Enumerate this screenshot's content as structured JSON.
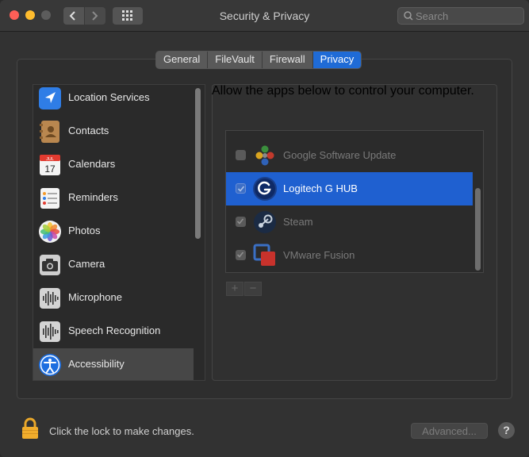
{
  "window": {
    "title": "Security & Privacy"
  },
  "toolbar": {
    "search_placeholder": "Search"
  },
  "tabs": [
    {
      "label": "General",
      "active": false
    },
    {
      "label": "FileVault",
      "active": false
    },
    {
      "label": "Firewall",
      "active": false
    },
    {
      "label": "Privacy",
      "active": true
    }
  ],
  "sidebar": {
    "items": [
      {
        "label": "Location Services",
        "icon": "location-arrow-icon"
      },
      {
        "label": "Contacts",
        "icon": "contacts-book-icon"
      },
      {
        "label": "Calendars",
        "icon": "calendar-icon",
        "icon_month": "JUL",
        "icon_day": "17"
      },
      {
        "label": "Reminders",
        "icon": "reminders-list-icon"
      },
      {
        "label": "Photos",
        "icon": "photos-flower-icon"
      },
      {
        "label": "Camera",
        "icon": "camera-icon"
      },
      {
        "label": "Microphone",
        "icon": "microphone-waveform-icon"
      },
      {
        "label": "Speech Recognition",
        "icon": "speech-waveform-icon"
      },
      {
        "label": "Accessibility",
        "icon": "accessibility-person-icon",
        "selected": true
      }
    ]
  },
  "main": {
    "description": "Allow the apps below to control your computer.",
    "apps": [
      {
        "name": "Google Software Update",
        "checked": false,
        "selected": false
      },
      {
        "name": "Logitech G HUB",
        "checked": true,
        "selected": true
      },
      {
        "name": "Steam",
        "checked": true,
        "selected": false
      },
      {
        "name": "VMware Fusion",
        "checked": true,
        "selected": false
      }
    ],
    "add_label": "+",
    "remove_label": "−"
  },
  "footer": {
    "lock_text": "Click the lock to make changes.",
    "advanced_label": "Advanced...",
    "help_label": "?"
  },
  "colors": {
    "accent": "#1f60d0",
    "background": "#323232"
  }
}
